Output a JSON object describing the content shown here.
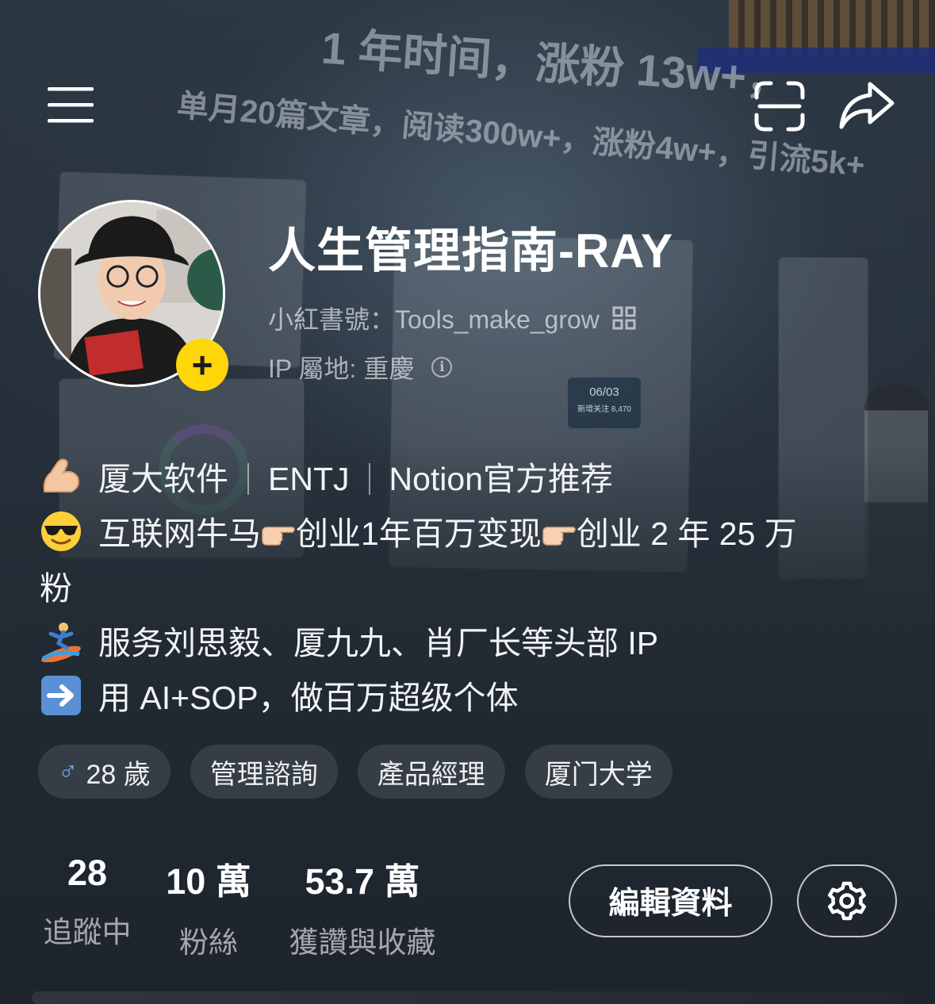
{
  "icons": {
    "menu": "menu-icon",
    "scan": "scan-icon",
    "share": "share-icon",
    "add_follow": "plus-icon",
    "info": "info-icon",
    "qr": "qr-icon",
    "settings": "gear-icon"
  },
  "banner": {
    "line1": "1 年时间，涨粉 13w+，",
    "line2": "单月20篇文章，阅读300w+，涨粉4w+，引流5k+",
    "popup_date": "06/03",
    "popup_sub": "新增关注 8,470"
  },
  "profile": {
    "nickname": "人生管理指南-RAY",
    "account_id": "小紅書號：Tools_make_grow",
    "ip_location": "IP 屬地: 重慶",
    "follow_symbol": "+"
  },
  "bio": {
    "line1_parts": [
      "厦大软件",
      "ENTJ",
      "Notion官方推荐"
    ],
    "line2_a": "互联网牛马",
    "line2_b": "创业1年百万变现",
    "line2_c": "创业 2 年 25 万",
    "line2_wrap": "粉",
    "line3": "服务刘思毅、厦九九、肖厂长等头部 IP",
    "line4": "用 AI+SOP，做百万超级个体"
  },
  "tags": [
    {
      "label": "28 歲",
      "icon": "male-icon",
      "symbol": "♂"
    },
    {
      "label": "管理諮詢"
    },
    {
      "label": "產品經理"
    },
    {
      "label": "厦门大学"
    }
  ],
  "stats": {
    "following": {
      "value": "28",
      "label": "追蹤中"
    },
    "fans": {
      "value": "10 萬",
      "label": "粉絲"
    },
    "likes": {
      "value": "53.7 萬",
      "label": "獲讚與收藏"
    }
  },
  "actions": {
    "edit_profile": "編輯資料"
  },
  "colors": {
    "follow_badge": "#ffd60a",
    "gender_icon": "#6aa8f0",
    "background": "#222b35"
  }
}
